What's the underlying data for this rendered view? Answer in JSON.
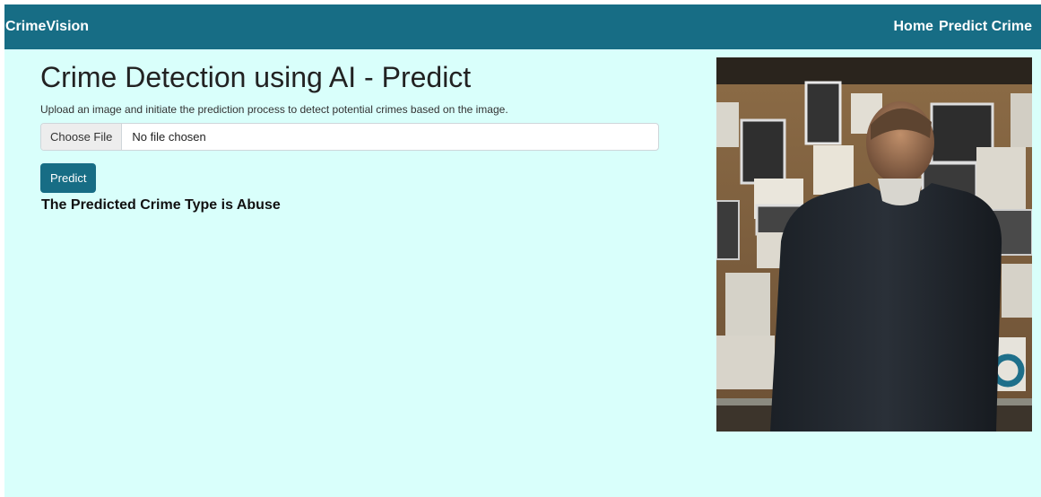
{
  "nav": {
    "brand": "CrimeVision",
    "links": [
      "Home",
      "Predict Crime"
    ]
  },
  "main": {
    "title": "Crime Detection using AI - Predict",
    "description": "Upload an image and initiate the prediction process to detect potential crimes based on the image.",
    "file_input": {
      "button_label": "Choose File",
      "status": "No file chosen"
    },
    "predict_label": "Predict",
    "result": "The Predicted Crime Type is Abuse"
  },
  "colors": {
    "navbar": "#176d85",
    "background": "#d9fffb",
    "accent": "#176d85"
  },
  "image": {
    "description_icon": "detective-evidence-board-photo"
  }
}
